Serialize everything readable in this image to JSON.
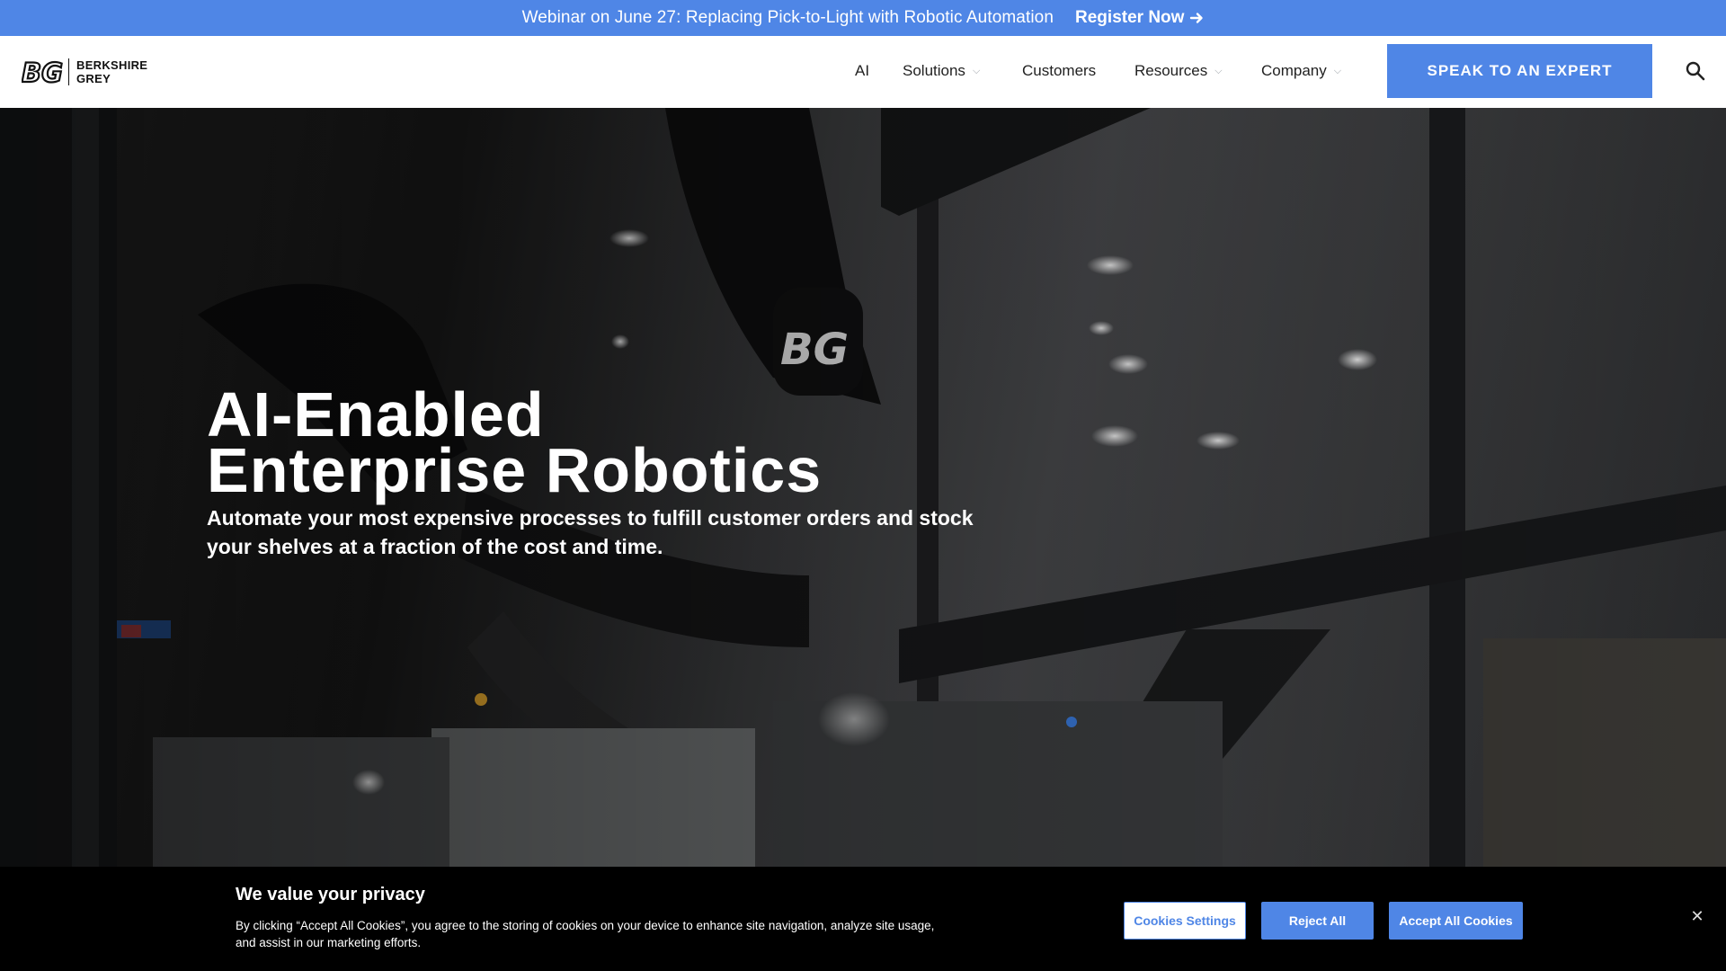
{
  "announcement": {
    "message": "Webinar on June 27: Replacing Pick-to-Light with Robotic Automation",
    "link_label": "Register Now",
    "link_icon": "arrow-right-icon"
  },
  "brand": {
    "line1": "BERKSHIRE",
    "line2": "GREY",
    "mark_icon": "bg-logo-icon"
  },
  "nav": {
    "items": [
      {
        "label": "AI",
        "has_dropdown": false
      },
      {
        "label": "Solutions",
        "has_dropdown": true
      },
      {
        "label": "Customers",
        "has_dropdown": false
      },
      {
        "label": "Resources",
        "has_dropdown": true
      },
      {
        "label": "Company",
        "has_dropdown": true
      }
    ],
    "cta_label": "SPEAK TO AN EXPERT",
    "search_icon": "search-icon"
  },
  "hero": {
    "title_line1": "AI-Enabled",
    "title_line2": "Enterprise Robotics",
    "subtitle": "Automate your most expensive processes to fulfill customer orders and stock your shelves at a fraction of the cost and time."
  },
  "cookie": {
    "title": "We value your privacy",
    "text": "By clicking “Accept All Cookies”, you agree to the storing of cookies on your device to enhance site navigation, analyze site usage, and assist in our marketing efforts.",
    "settings_label": "Cookies Settings",
    "reject_label": "Reject All",
    "accept_label": "Accept All Cookies",
    "close_icon": "close-icon"
  },
  "colors": {
    "accent": "#4f86e6",
    "banner_bg": "#000000",
    "header_bg": "#ffffff"
  }
}
